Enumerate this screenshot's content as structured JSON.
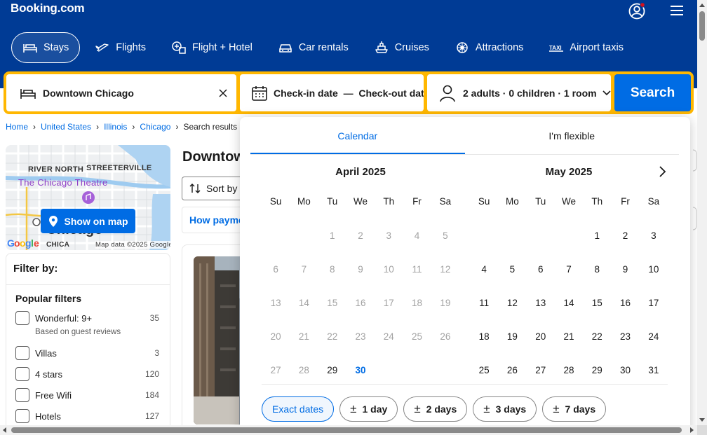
{
  "header": {
    "logo": "Booking.com",
    "user_icon": "user-account-icon",
    "menu_icon": "hamburger-menu-icon",
    "nav": [
      {
        "label": "Stays",
        "icon": "bed-icon",
        "active": true
      },
      {
        "label": "Flights",
        "icon": "plane-icon"
      },
      {
        "label": "Flight + Hotel",
        "icon": "flight-hotel-icon"
      },
      {
        "label": "Car rentals",
        "icon": "car-icon"
      },
      {
        "label": "Cruises",
        "icon": "ship-icon"
      },
      {
        "label": "Attractions",
        "icon": "attractions-icon"
      },
      {
        "label": "Airport taxis",
        "icon": "taxi-icon"
      }
    ]
  },
  "search": {
    "destination": "Downtown Chicago",
    "dates_label": "Check-in date  —  Check-out date",
    "guests_label": "2 adults · 0 children · 1 room",
    "search_button": "Search"
  },
  "breadcrumb": [
    "Home",
    "United States",
    "Illinois",
    "Chicago",
    "Search results"
  ],
  "map": {
    "labels": [
      "RIVER NORTH",
      "STREETERVILLE",
      "The Chicago Theatre",
      "Chicago",
      "CHICA"
    ],
    "attribution": "Map data ©2025 Google",
    "button": "Show on map"
  },
  "filters": {
    "title": "Filter by:",
    "popular_title": "Popular filters",
    "items": [
      {
        "label": "Wonderful: 9+",
        "count": "35",
        "sub": "Based on guest reviews"
      },
      {
        "label": "Villas",
        "count": "3"
      },
      {
        "label": "4 stars",
        "count": "120"
      },
      {
        "label": "Free Wifi",
        "count": "184"
      },
      {
        "label": "Hotels",
        "count": "127"
      }
    ]
  },
  "results": {
    "title": "Downtown Chicago",
    "sort_label": "Sort by",
    "payment_label": "How payment works"
  },
  "calendar": {
    "tabs": [
      "Calendar",
      "I'm flexible"
    ],
    "weekdays": [
      "Su",
      "Mo",
      "Tu",
      "We",
      "Th",
      "Fr",
      "Sa"
    ],
    "months": [
      {
        "title": "April 2025",
        "weeks": [
          [
            "",
            "",
            "1",
            "2",
            "3",
            "4",
            "5"
          ],
          [
            "6",
            "7",
            "8",
            "9",
            "10",
            "11",
            "12"
          ],
          [
            "13",
            "14",
            "15",
            "16",
            "17",
            "18",
            "19"
          ],
          [
            "20",
            "21",
            "22",
            "23",
            "24",
            "25",
            "26"
          ],
          [
            "27",
            "28",
            "29",
            "30",
            "",
            "",
            ""
          ]
        ],
        "past_through": 28,
        "today": 30
      },
      {
        "title": "May 2025",
        "weeks": [
          [
            "",
            "",
            "",
            "",
            "1",
            "2",
            "3"
          ],
          [
            "4",
            "5",
            "6",
            "7",
            "8",
            "9",
            "10"
          ],
          [
            "11",
            "12",
            "13",
            "14",
            "15",
            "16",
            "17"
          ],
          [
            "18",
            "19",
            "20",
            "21",
            "22",
            "23",
            "24"
          ],
          [
            "25",
            "26",
            "27",
            "28",
            "29",
            "30",
            "31"
          ]
        ]
      }
    ],
    "flex_options": [
      "Exact dates",
      "1 day",
      "2 days",
      "3 days",
      "7 days"
    ],
    "plus_minus": "±"
  },
  "colors": {
    "brand": "#003b95",
    "accent": "#006ce4",
    "search_border": "#ffb700"
  }
}
